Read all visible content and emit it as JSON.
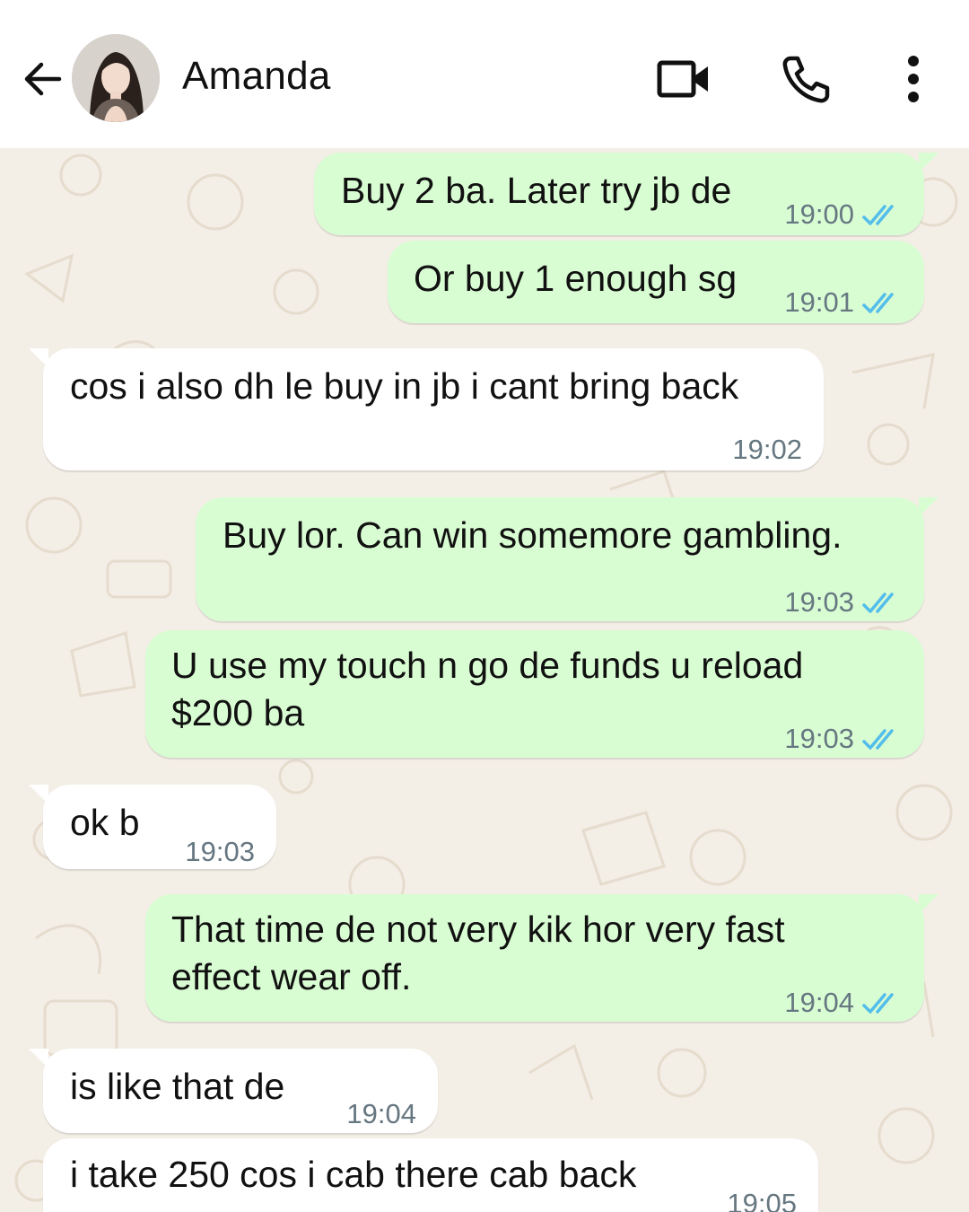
{
  "header": {
    "contact_name": "Amanda",
    "back_icon": "arrow-left-icon",
    "video_icon": "video-camera-icon",
    "call_icon": "phone-icon",
    "menu_icon": "more-vertical-icon"
  },
  "colors": {
    "outgoing_bubble": "#d9fdd3",
    "incoming_bubble": "#ffffff",
    "read_ticks": "#53bdeb",
    "timestamp": "#667781",
    "wallpaper": "#f3eee6"
  },
  "messages": [
    {
      "direction": "out",
      "text": "Buy 2 ba. Later try jb de",
      "time": "19:00",
      "status": "read"
    },
    {
      "direction": "out",
      "text": "Or buy 1 enough sg",
      "time": "19:01",
      "status": "read"
    },
    {
      "direction": "in",
      "text": "cos i also dh le buy in jb i cant bring back",
      "time": "19:02"
    },
    {
      "direction": "out",
      "text": "Buy lor. Can win somemore gambling.",
      "time": "19:03",
      "status": "read"
    },
    {
      "direction": "out",
      "text": "U use my touch n go de funds u reload\n$200 ba",
      "time": "19:03",
      "status": "read"
    },
    {
      "direction": "in",
      "text": "ok b",
      "time": "19:03"
    },
    {
      "direction": "out",
      "text": "That time de not very kik hor very fast\neffect wear off.",
      "time": "19:04",
      "status": "read"
    },
    {
      "direction": "in",
      "text": "is like that de",
      "time": "19:04"
    },
    {
      "direction": "in",
      "text": "i take 250 cos i cab there cab back",
      "time": "19:05"
    }
  ]
}
